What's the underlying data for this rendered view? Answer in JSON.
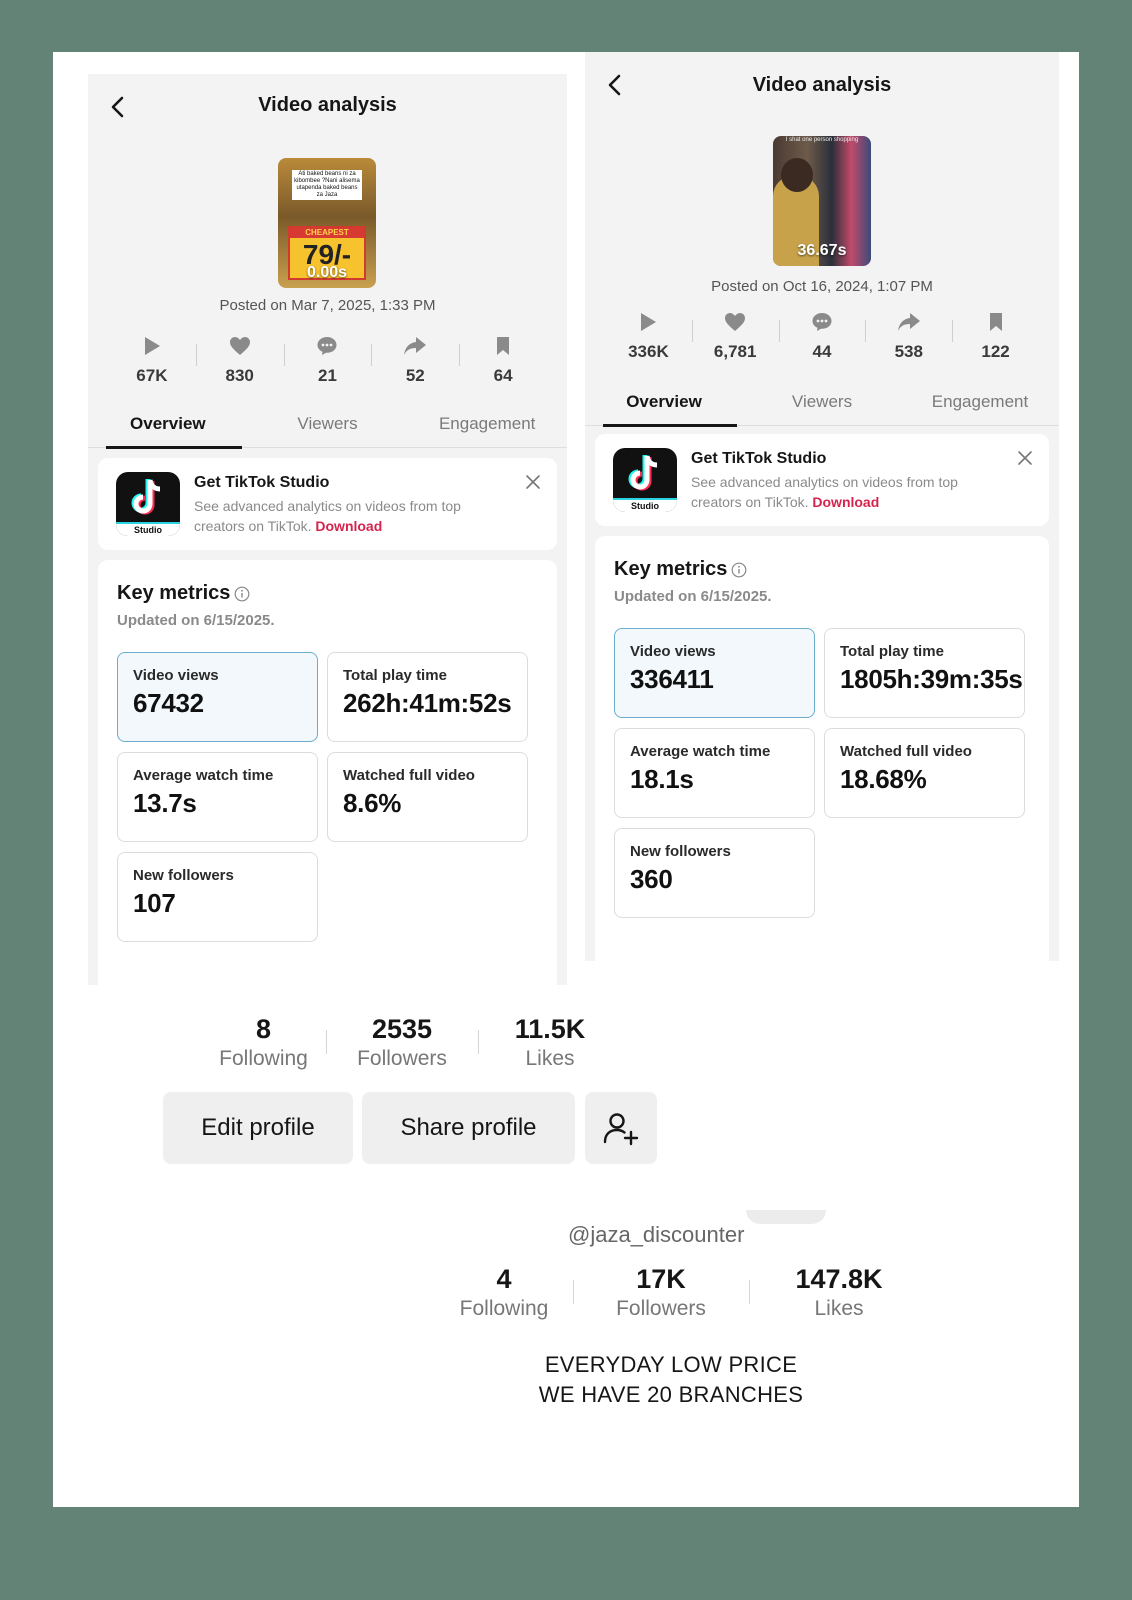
{
  "left_panel": {
    "title": "Video analysis",
    "thumb_caption": "Ati baked beans ni za kibombee ?Nani alisema utapenda baked beans za Jaza",
    "thumb_badge": "CHEAPEST",
    "thumb_price": "79/-",
    "duration": "0.00s",
    "posted": "Posted on Mar 7, 2025, 1:33 PM",
    "stats": [
      {
        "icon": "play-icon",
        "value": "67K"
      },
      {
        "icon": "heart-icon",
        "value": "830"
      },
      {
        "icon": "comment-icon",
        "value": "21"
      },
      {
        "icon": "share-icon",
        "value": "52"
      },
      {
        "icon": "bookmark-icon",
        "value": "64"
      }
    ],
    "tabs": [
      "Overview",
      "Viewers",
      "Engagement"
    ],
    "promo": {
      "logo_label": "Studio",
      "title": "Get TikTok Studio",
      "desc": "See advanced analytics on videos from top creators on TikTok.",
      "link": "Download"
    },
    "metrics": {
      "title": "Key metrics",
      "updated": "Updated on 6/15/2025.",
      "cards": [
        {
          "label": "Video views",
          "value": "67432"
        },
        {
          "label": "Total play time",
          "value": "262h:41m:52s"
        },
        {
          "label": "Average watch time",
          "value": "13.7s"
        },
        {
          "label": "Watched full video",
          "value": "8.6%"
        },
        {
          "label": "New followers",
          "value": "107"
        }
      ]
    }
  },
  "right_panel": {
    "title": "Video analysis",
    "thumb_hint": "I shat one person shopping",
    "duration": "36.67s",
    "posted": "Posted on Oct 16, 2024, 1:07 PM",
    "stats": [
      {
        "icon": "play-icon",
        "value": "336K"
      },
      {
        "icon": "heart-icon",
        "value": "6,781"
      },
      {
        "icon": "comment-icon",
        "value": "44"
      },
      {
        "icon": "share-icon",
        "value": "538"
      },
      {
        "icon": "bookmark-icon",
        "value": "122"
      }
    ],
    "tabs": [
      "Overview",
      "Viewers",
      "Engagement"
    ],
    "promo": {
      "logo_label": "Studio",
      "title": "Get TikTok Studio",
      "desc": "See advanced analytics on videos from top creators on TikTok.",
      "link": "Download"
    },
    "metrics": {
      "title": "Key metrics",
      "updated": "Updated on 6/15/2025.",
      "cards": [
        {
          "label": "Video views",
          "value": "336411"
        },
        {
          "label": "Total play time",
          "value": "1805h:39m:35s"
        },
        {
          "label": "Average watch time",
          "value": "18.1s"
        },
        {
          "label": "Watched full video",
          "value": "18.68%"
        },
        {
          "label": "New followers",
          "value": "360"
        }
      ]
    }
  },
  "profile1": {
    "stats": [
      {
        "value": "8",
        "label": "Following"
      },
      {
        "value": "2535",
        "label": "Followers"
      },
      {
        "value": "11.5K",
        "label": "Likes"
      }
    ],
    "edit_label": "Edit profile",
    "share_label": "Share profile",
    "add_friend_icon": "add-user-icon"
  },
  "profile2": {
    "handle": "@jaza_discounter",
    "stats": [
      {
        "value": "4",
        "label": "Following"
      },
      {
        "value": "17K",
        "label": "Followers"
      },
      {
        "value": "147.8K",
        "label": "Likes"
      }
    ],
    "bio_line1": "EVERYDAY LOW PRICE",
    "bio_line2": "WE HAVE 20 BRANCHES"
  },
  "colors": {
    "background": "#638376",
    "accent_link": "#d4244f",
    "selected_card_border": "#6aaecc"
  }
}
